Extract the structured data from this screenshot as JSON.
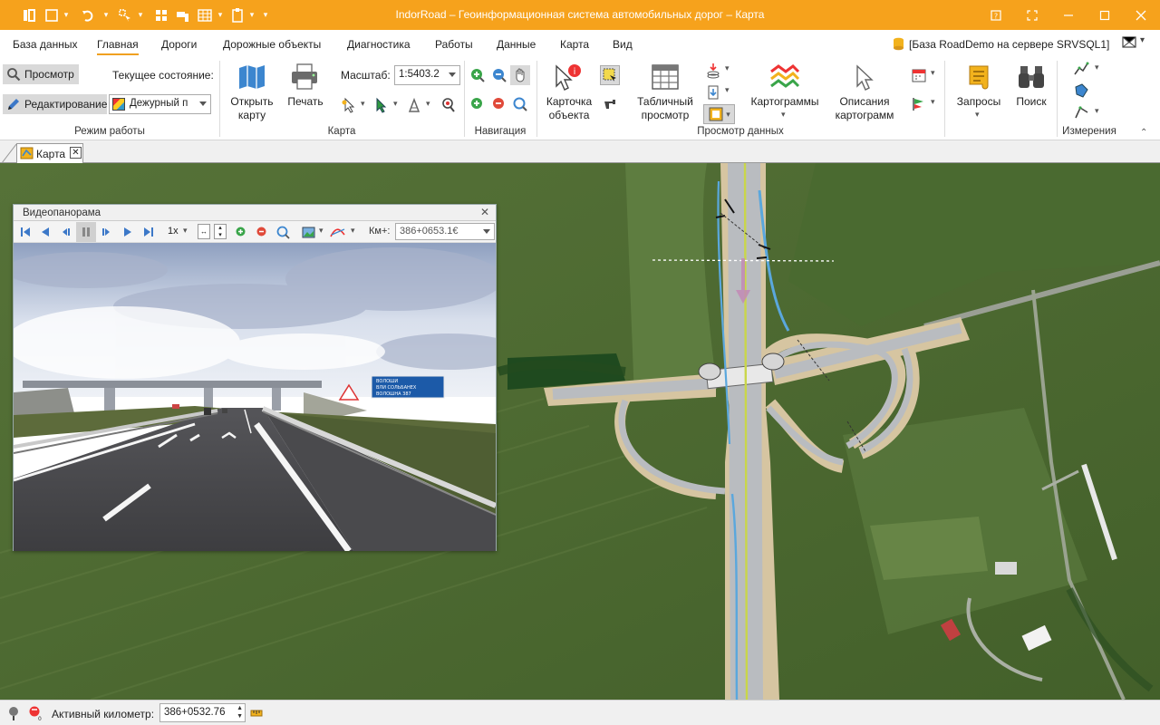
{
  "window": {
    "title": "IndorRoad – Геоинформационная система автомобильных дорог – Карта"
  },
  "menu": {
    "items": [
      "База данных",
      "Главная",
      "Дороги",
      "Дорожные объекты",
      "Диагностика",
      "Работы",
      "Данные",
      "Карта",
      "Вид"
    ],
    "active_index": 1,
    "database_label": "[База RoadDemo на сервере SRVSQL1]"
  },
  "ribbon": {
    "mode": {
      "view_label": "Просмотр",
      "edit_label": "Редактирование",
      "state_label": "Текущее состояние:",
      "state_value": "Дежурный п",
      "group_label": "Режим работы"
    },
    "map": {
      "open_label": "Открыть карту",
      "print_label": "Печать",
      "scale_label": "Масштаб:",
      "scale_value": "1:5403.2",
      "group_label": "Карта"
    },
    "navigation": {
      "group_label": "Навигация"
    },
    "data_view": {
      "card_label": "Карточка объекта",
      "table_label": "Табличный просмотр",
      "cartograms_label": "Картограммы",
      "descriptions_label": "Описания картограмм",
      "group_label": "Просмотр данных"
    },
    "queries_label": "Запросы",
    "search_label": "Поиск",
    "measure": {
      "group_label": "Измерения"
    }
  },
  "tabs": [
    {
      "label": "Карта"
    }
  ],
  "video_panel": {
    "title": "Видеопанорама",
    "speed": "1x",
    "km_label": "Км+:",
    "km_value": "386+0653.1€",
    "sign_lines": [
      "ВОЛОШИ",
      "ВЛИ СОЛЬБАНЕХ",
      "ВОЛОШНА 387"
    ]
  },
  "status": {
    "active_km_label": "Активный километр:",
    "active_km_value": "386+0532.76"
  },
  "colors": {
    "title_bar": "#f6a21c",
    "accent": "#f0a020",
    "map_field": "#4f6a2f"
  }
}
